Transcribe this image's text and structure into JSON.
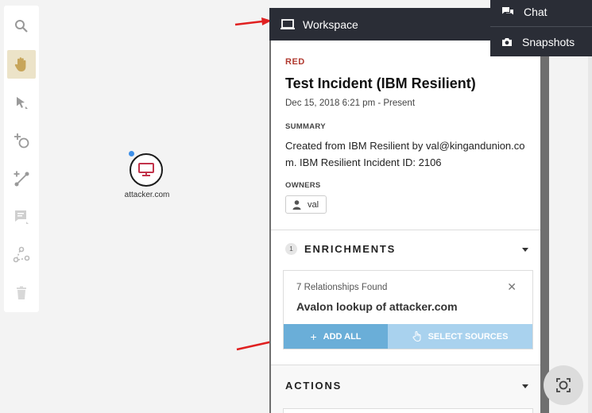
{
  "toolbar": {
    "tools": [
      {
        "name": "search-icon",
        "active": false
      },
      {
        "name": "hand-icon",
        "active": true
      },
      {
        "name": "select-pointer-icon",
        "active": false
      },
      {
        "name": "add-node-icon",
        "active": false
      },
      {
        "name": "add-edge-icon",
        "active": false
      },
      {
        "name": "comment-icon",
        "active": false
      },
      {
        "name": "ungroup-icon",
        "active": false
      },
      {
        "name": "trash-icon",
        "active": false
      }
    ]
  },
  "canvas": {
    "node": {
      "label": "attacker.com",
      "icon": "monitor-icon",
      "accent": "#c2334a"
    }
  },
  "panel": {
    "header_title": "Workspace",
    "severity": "RED",
    "severity_color": "#b0392f",
    "title": "Test Incident (IBM Resilient)",
    "date_range": "Dec 15, 2018 6:21 pm - Present",
    "summary_label": "SUMMARY",
    "summary_text": "Created from IBM Resilient by val@kingandunion.com. IBM Resilient Incident ID: 2106",
    "owners_label": "OWNERS",
    "owner_name": "val",
    "enrichments": {
      "count": "1",
      "title": "ENRICHMENTS",
      "card": {
        "subtitle": "7 Relationships Found",
        "title": "Avalon lookup of attacker.com",
        "close": "✕",
        "add_all_label": "ADD ALL",
        "select_sources_label": "SELECT SOURCES"
      }
    },
    "actions": {
      "title": "ACTIONS"
    }
  },
  "menu": {
    "items": [
      {
        "label": "Chat",
        "icon": "chat-icon"
      },
      {
        "label": "Snapshots",
        "icon": "camera-icon"
      }
    ]
  },
  "colors": {
    "panel_header": "#2a2d36",
    "btn_primary": "#6aaed8",
    "btn_secondary": "#a9d2ee",
    "arrow": "#e02020"
  }
}
